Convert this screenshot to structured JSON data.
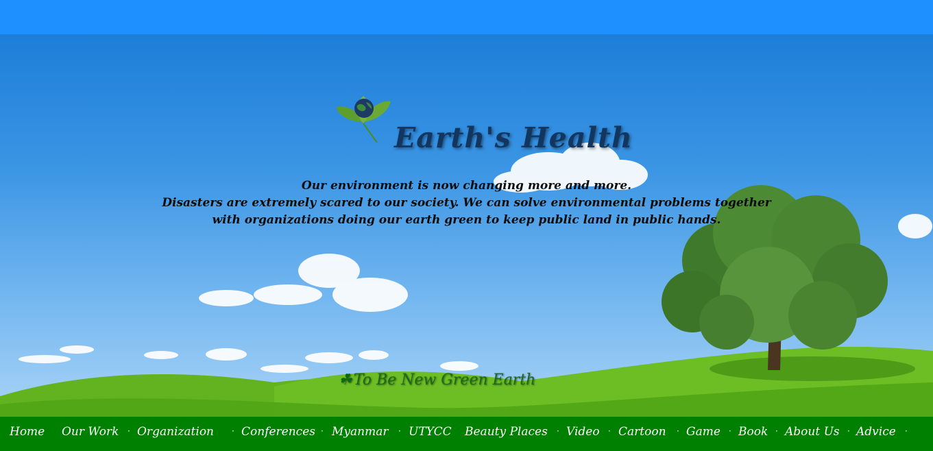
{
  "header": {
    "title": "Earth's Health",
    "logo_icon": "leaf-globe-icon"
  },
  "intro": {
    "lines": [
      "Our environment is now changing more and more.",
      "Disasters are extremely scared to our society. We can solve environmental problems together",
      "with organizations doing our earth green to keep public land in public hands."
    ]
  },
  "tagline": {
    "icon": "shamrock-icon",
    "glyph": "☘",
    "text": "To Be New Green Earth"
  },
  "nav": {
    "items": [
      "Home",
      "Our Work",
      "Organization",
      "Conferences",
      "Myanmar",
      "UTYCC",
      "Beauty Places",
      "Video",
      "Cartoon",
      "Game",
      "Book",
      "About Us",
      "Advice"
    ],
    "separator": "·"
  },
  "colors": {
    "topbar": "#1e90ff",
    "navbar": "#008000",
    "title": "#12365f"
  }
}
